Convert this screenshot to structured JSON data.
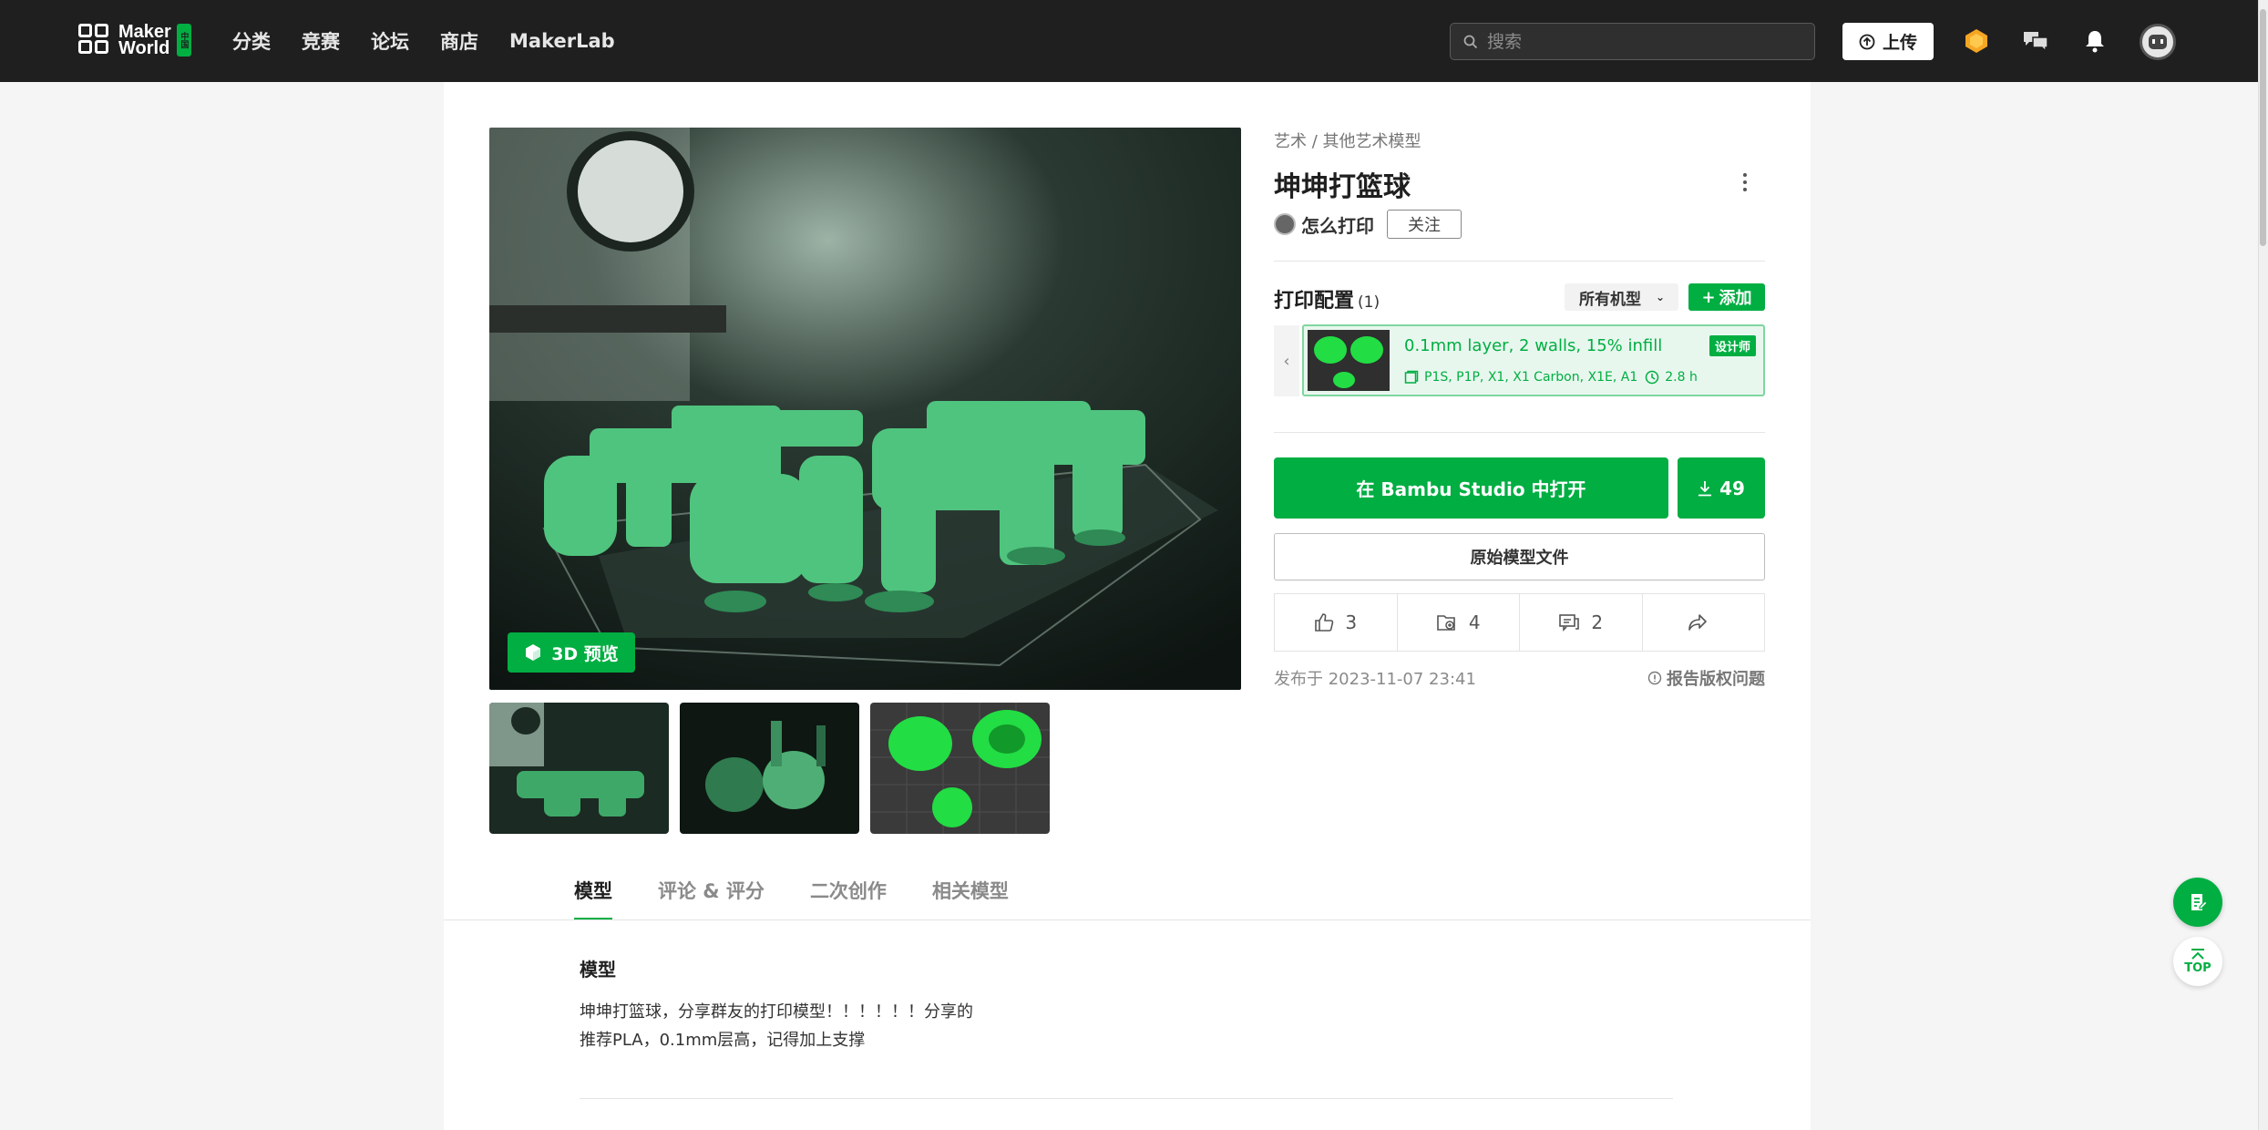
{
  "header": {
    "logo_text_line1": "Maker",
    "logo_text_line2": "World",
    "logo_badge": "中国",
    "nav": [
      "分类",
      "竞赛",
      "论坛",
      "商店",
      "MakerLab"
    ],
    "search_placeholder": "搜索",
    "upload_label": "上传",
    "icons": [
      "upload-icon",
      "coin-icon",
      "message-icon",
      "bell-icon",
      "user-avatar"
    ]
  },
  "gallery": {
    "preview_label": "3D 预览",
    "thumbnails": [
      "thumbnail-1",
      "thumbnail-2",
      "thumbnail-3"
    ]
  },
  "model": {
    "breadcrumb": "艺术 / 其他艺术模型",
    "title": "坤坤打篮球",
    "author": "怎么打印",
    "follow_label": "关注"
  },
  "print_config": {
    "label": "打印配置",
    "count": "(1)",
    "machine_filter": "所有机型",
    "add_label": "添加",
    "profile_name": "0.1mm layer, 2 walls, 15% infill",
    "designer_badge": "设计师",
    "printers": "P1S, P1P, X1, X1 Carbon, X1E, A1",
    "print_time": "2.8 h"
  },
  "actions": {
    "open_label": "在 Bambu Studio 中打开",
    "download_count": "49",
    "raw_file_label": "原始模型文件",
    "likes": "3",
    "collections": "4",
    "comments": "2"
  },
  "meta": {
    "published": "发布于 2023-11-07 23:41",
    "report_label": "报告版权问题"
  },
  "tabs": [
    "模型",
    "评论 & 评分",
    "二次创作",
    "相关模型"
  ],
  "description": {
    "section_title": "模型",
    "line1": "坤坤打篮球，分享群友的打印模型！！！！！！分享的",
    "line2": "推荐PLA，0.1mm层高，记得加上支撑"
  },
  "floating": {
    "top_label": "TOP"
  },
  "colors": {
    "brand_green": "#00ae42",
    "topbar": "#1f1f1f"
  }
}
